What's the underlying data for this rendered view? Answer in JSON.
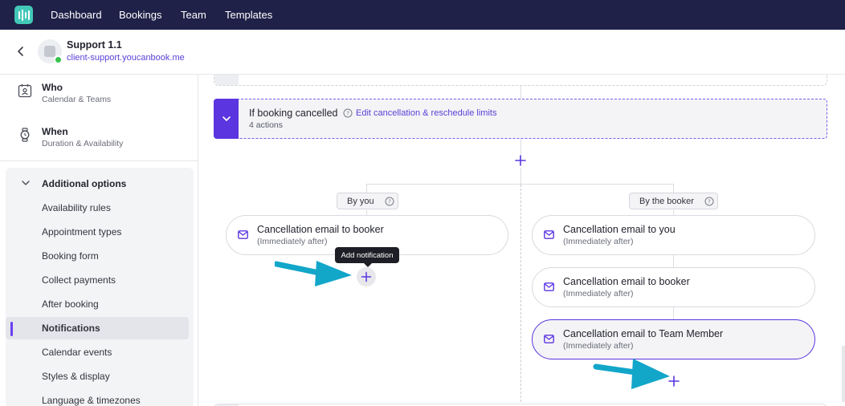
{
  "nav": {
    "items": [
      "Dashboard",
      "Bookings",
      "Team",
      "Templates"
    ]
  },
  "header": {
    "title": "Support 1.1",
    "link": "client-support.youcanbook.me"
  },
  "sidebar": {
    "who": {
      "title": "Who",
      "subtitle": "Calendar & Teams"
    },
    "when": {
      "title": "When",
      "subtitle": "Duration & Availability"
    },
    "additional": {
      "label": "Additional options",
      "items": [
        "Availability rules",
        "Appointment types",
        "Booking form",
        "Collect payments",
        "After booking",
        "Notifications",
        "Calendar events",
        "Styles & display",
        "Language & timezones"
      ],
      "active": "Notifications"
    }
  },
  "flow": {
    "trigger": {
      "title": "If booking cancelled",
      "link": "Edit cancellation & reschedule limits",
      "subtitle": "4 actions"
    },
    "branches": {
      "left": {
        "label": "By you",
        "notifications": [
          {
            "title": "Cancellation email to booker",
            "timing": "(Immediately after)"
          }
        ]
      },
      "right": {
        "label": "By the booker",
        "notifications": [
          {
            "title": "Cancellation email to you",
            "timing": "(Immediately after)"
          },
          {
            "title": "Cancellation email to booker",
            "timing": "(Immediately after)"
          },
          {
            "title": "Cancellation email to Team Member",
            "timing": "(Immediately after)"
          }
        ]
      }
    },
    "tooltip": "Add notification"
  },
  "colors": {
    "topnav": "#1f2148",
    "accent": "#5a35e0",
    "arrow": "#12a6c9"
  }
}
